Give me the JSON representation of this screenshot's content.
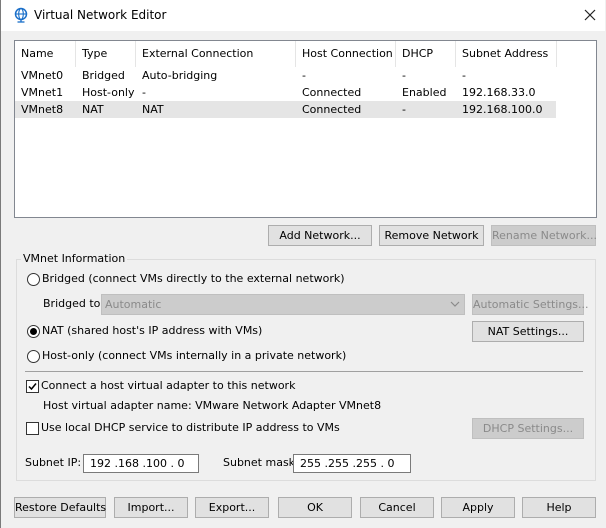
{
  "window": {
    "title": "Virtual Network Editor"
  },
  "table": {
    "columns": [
      "Name",
      "Type",
      "External Connection",
      "Host Connection",
      "DHCP",
      "Subnet Address"
    ],
    "rows": [
      [
        "VMnet0",
        "Bridged",
        "Auto-bridging",
        "-",
        "-",
        "-"
      ],
      [
        "VMnet1",
        "Host-only",
        "-",
        "Connected",
        "Enabled",
        "192.168.33.0"
      ],
      [
        "VMnet8",
        "NAT",
        "NAT",
        "Connected",
        "-",
        "192.168.100.0"
      ]
    ],
    "selected_row": "VMnet8"
  },
  "network_buttons": {
    "add": "Add Network...",
    "remove": "Remove Network",
    "rename": "Rename Network..."
  },
  "vmnet_info": {
    "group_title": "VMnet Information",
    "bridged_label": "Bridged (connect VMs directly to the external network)",
    "bridged_to_label": "Bridged to:",
    "bridged_to_value": "Automatic",
    "automatic_settings": "Automatic Settings...",
    "nat_label": "NAT (shared host's IP address with VMs)",
    "nat_settings": "NAT Settings...",
    "hostonly_label": "Host-only (connect VMs internally in a private network)",
    "selected_mode": "NAT",
    "connect_adapter_label": "Connect a host virtual adapter to this network",
    "connect_adapter_checked": true,
    "adapter_name_text": "Host virtual adapter name: VMware Network Adapter VMnet8",
    "dhcp_label": "Use local DHCP service to distribute IP address to VMs",
    "dhcp_checked": false,
    "dhcp_settings": "DHCP Settings...",
    "subnet_ip_label": "Subnet IP:",
    "subnet_ip_value": "192 .168 .100 .  0",
    "subnet_mask_label": "Subnet mask:",
    "subnet_mask_value": "255 .255 .255 .  0"
  },
  "footer": {
    "restore": "Restore Defaults",
    "import": "Import...",
    "export": "Export...",
    "ok": "OK",
    "cancel": "Cancel",
    "apply": "Apply",
    "help": "Help"
  },
  "icons": {
    "title_icon": "network-globe-icon",
    "close": "close-icon"
  },
  "colors": {
    "title_icon": "#1a6fc9",
    "selected_row": "#e5e5e5",
    "disabled_text": "#8a8a8a"
  }
}
